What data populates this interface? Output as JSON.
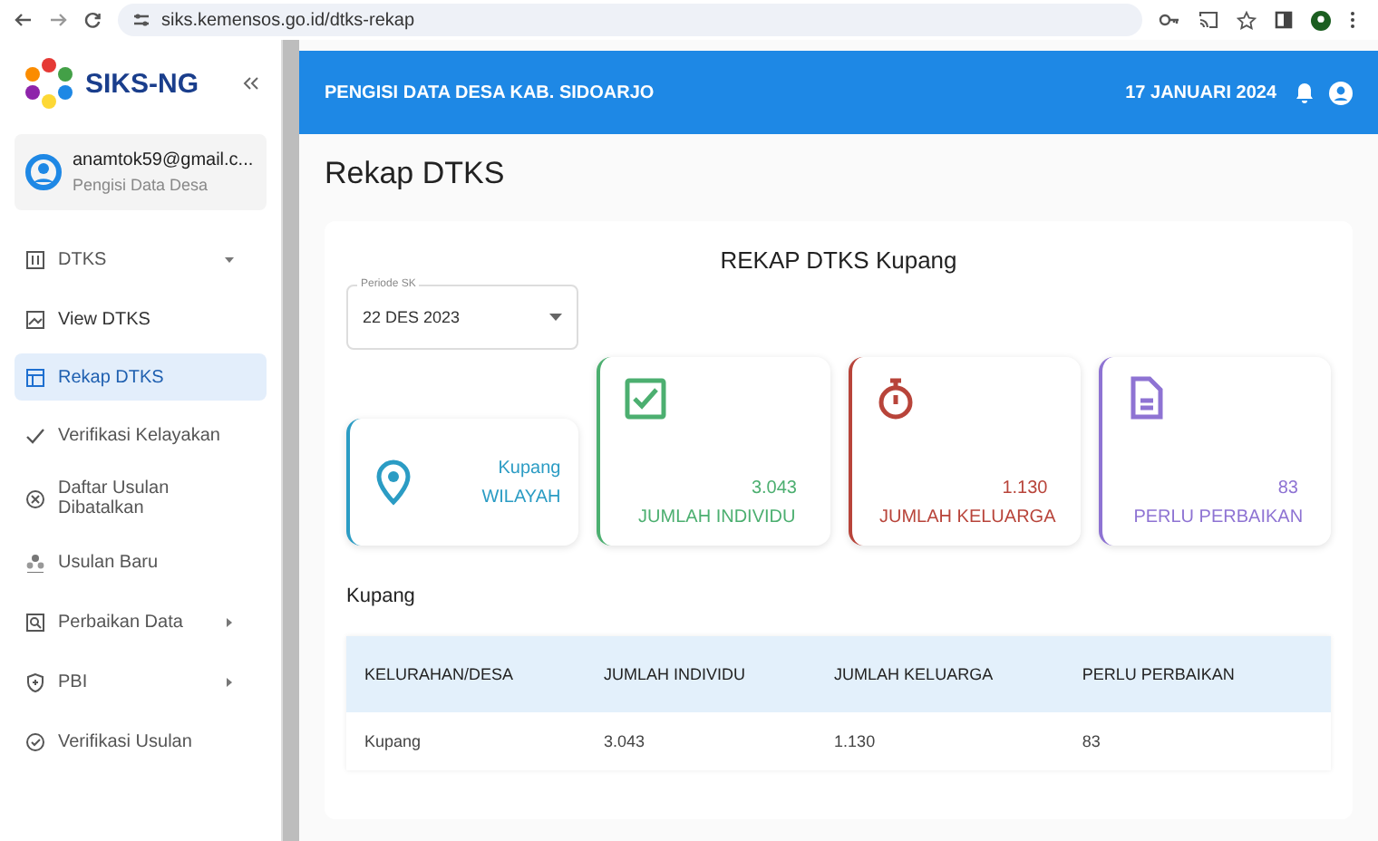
{
  "browser": {
    "url": "siks.kemensos.go.id/dtks-rekap"
  },
  "sidebar": {
    "logo_text": "SIKS-NG",
    "user": {
      "email": "anamtok59@gmail.c...",
      "role": "Pengisi Data Desa"
    },
    "items": [
      {
        "label": "DTKS",
        "kind": "group",
        "expanded": true,
        "selected": false,
        "children": [
          {
            "label": "View DTKS",
            "selected": false
          },
          {
            "label": "Rekap DTKS",
            "selected": true
          }
        ]
      },
      {
        "label": "Verifikasi Kelayakan",
        "kind": "link",
        "selected": false
      },
      {
        "label": "Daftar Usulan Dibatalkan",
        "kind": "link",
        "selected": false
      },
      {
        "label": "Usulan Baru",
        "kind": "link",
        "selected": false
      },
      {
        "label": "Perbaikan Data",
        "kind": "group",
        "expanded": false,
        "selected": false
      },
      {
        "label": "PBI",
        "kind": "group",
        "expanded": false,
        "selected": false
      },
      {
        "label": "Verifikasi Usulan",
        "kind": "link",
        "selected": false
      }
    ]
  },
  "header": {
    "title": "PENGISI DATA DESA KAB. SIDOARJO",
    "date": "17 JANUARI 2024"
  },
  "page_title": "Rekap DTKS",
  "card": {
    "title": "REKAP DTKS Kupang",
    "period": {
      "label": "Periode SK",
      "value": "22 DES 2023"
    },
    "stats": [
      {
        "kind": "location",
        "value": "Kupang",
        "label": "WILAYAH",
        "color": "#2b9cc4"
      },
      {
        "kind": "check",
        "value": "3.043",
        "label": "JUMLAH INDIVIDU",
        "color": "#4caf70"
      },
      {
        "kind": "timer",
        "value": "1.130",
        "label": "JUMLAH KELUARGA",
        "color": "#b8443a"
      },
      {
        "kind": "document",
        "value": "83",
        "label": "PERLU PERBAIKAN",
        "color": "#8e73d3"
      }
    ],
    "section": "Kupang",
    "table": {
      "columns": [
        "KELURAHAN/DESA",
        "JUMLAH INDIVIDU",
        "JUMLAH KELUARGA",
        "PERLU PERBAIKAN"
      ],
      "rows": [
        [
          "Kupang",
          "3.043",
          "1.130",
          "83"
        ]
      ]
    }
  }
}
